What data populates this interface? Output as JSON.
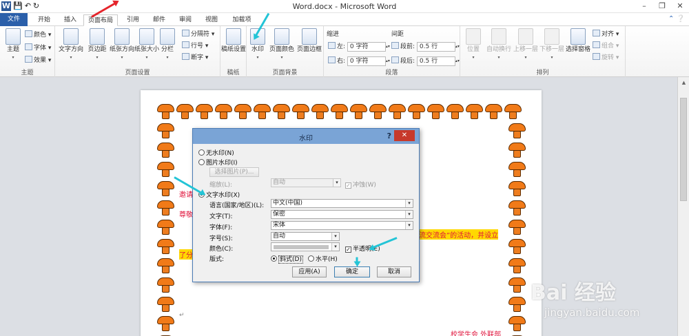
{
  "window": {
    "title": "Word.docx - Microsoft Word",
    "logo": "W",
    "controls": [
      "–",
      "❐",
      "✕"
    ]
  },
  "qat": {
    "save": "💾",
    "undo": "↶",
    "redo": "↻"
  },
  "tabs": [
    "文件",
    "开始",
    "插入",
    "页面布局",
    "引用",
    "邮件",
    "审阅",
    "视图",
    "加载项"
  ],
  "ribbon": {
    "theme": {
      "label": "主题",
      "themes": "主题",
      "colors": "颜色",
      "fonts": "字体",
      "effects": "效果"
    },
    "page_setup": {
      "label": "页面设置",
      "text_dir": "文字方向",
      "margins": "页边距",
      "orientation": "纸张方向",
      "size": "纸张大小",
      "columns": "分栏",
      "breaks": "分隔符",
      "line_numbers": "行号",
      "hyphenation": "断字"
    },
    "manuscript": {
      "label": "稿纸",
      "setting": "稿纸设置"
    },
    "page_bg": {
      "label": "页面背景",
      "watermark": "水印",
      "page_color": "页面颜色",
      "page_border": "页面边框"
    },
    "paragraph": {
      "label": "段落",
      "indent": "缩进",
      "spacing": "间距",
      "left": "左:",
      "right": "右:",
      "before": "段前:",
      "after": "段后:",
      "left_val": "0 字符",
      "right_val": "0 字符",
      "before_val": "0.5 行",
      "after_val": "0.5 行"
    },
    "arrange": {
      "label": "排列",
      "position": "位置",
      "wrap": "自动换行",
      "forward": "上移一层",
      "backward": "下移一层",
      "pane": "选择窗格",
      "align": "对齐",
      "group": "组合",
      "rotate": "旋转"
    }
  },
  "document": {
    "line1": "邀请",
    "line2": "尊敬",
    "line3_left": "了分",
    "line3_right": "流交流会”的活动，并设立",
    "signature": "校学生会 外联部"
  },
  "dialog": {
    "title": "水印",
    "help": "?",
    "no_watermark": "无水印(N)",
    "picture_watermark": "图片水印(I)",
    "select_picture": "选择图片(P)...",
    "scale_label": "缩放(L):",
    "scale_value": "自动",
    "washout": "冲蚀(W)",
    "text_watermark": "文字水印(X)",
    "language_label": "语言(国家/地区)(L):",
    "language_value": "中文(中国)",
    "text_label": "文字(T):",
    "text_value": "保密",
    "font_label": "字体(F):",
    "font_value": "宋体",
    "size_label": "字号(S):",
    "size_value": "自动",
    "color_label": "颜色(C):",
    "semitransparent": "半透明(E)",
    "layout_label": "版式:",
    "diagonal": "斜式(D)",
    "horizontal": "水平(H)",
    "apply": "应用(A)",
    "ok": "确定",
    "cancel": "取消"
  },
  "watermark_brand": {
    "line1": "Bai 经验",
    "line2": "jingyan.baidu.com"
  },
  "colors": {
    "accent": "#2a5faa",
    "arrow_red": "#e5242b",
    "arrow_cyan": "#23c4d6",
    "border_orange": "#f17a18"
  }
}
